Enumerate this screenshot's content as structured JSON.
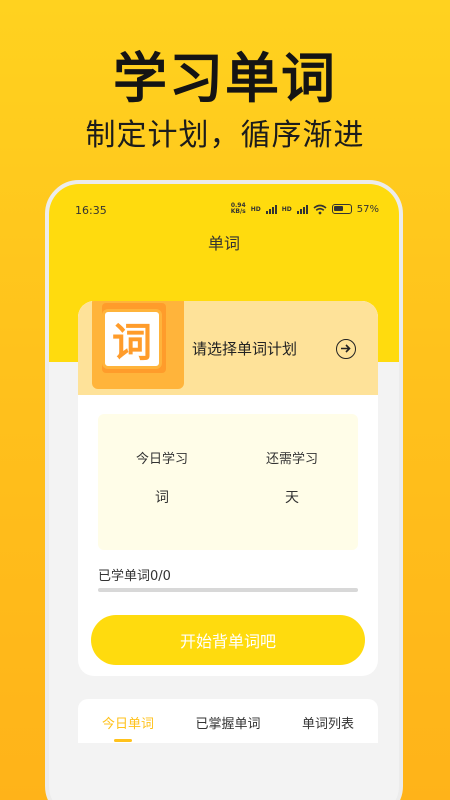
{
  "promo": {
    "title": "学习单词",
    "subtitle": "制定计划，循序渐进"
  },
  "status_bar": {
    "time": "16:35",
    "net_speed_value": "0.94",
    "net_speed_unit": "KB/s",
    "hd_1": "HD",
    "hd_2": "HD",
    "battery": "57%"
  },
  "nav": {
    "title": "单词"
  },
  "plan": {
    "icon_char": "词",
    "text": "请选择单词计划"
  },
  "stats": {
    "today_label": "今日学习",
    "today_value": "词",
    "remaining_label": "还需学习",
    "remaining_value": "天"
  },
  "progress": {
    "label": "已学单词0/0",
    "fraction": 0
  },
  "start_button": {
    "label": "开始背单词吧"
  },
  "tabs": [
    {
      "label": "今日单词",
      "active": true
    },
    {
      "label": "已掌握单词",
      "active": false
    },
    {
      "label": "单词列表",
      "active": false
    }
  ],
  "colors": {
    "accent": "#FFDB0E",
    "accent_text": "#FFC21C",
    "banner": "#FEE299"
  },
  "icons": [
    "wifi-icon",
    "signal-icon",
    "battery-icon",
    "arrow-right-circle-icon",
    "word-book-icon"
  ]
}
